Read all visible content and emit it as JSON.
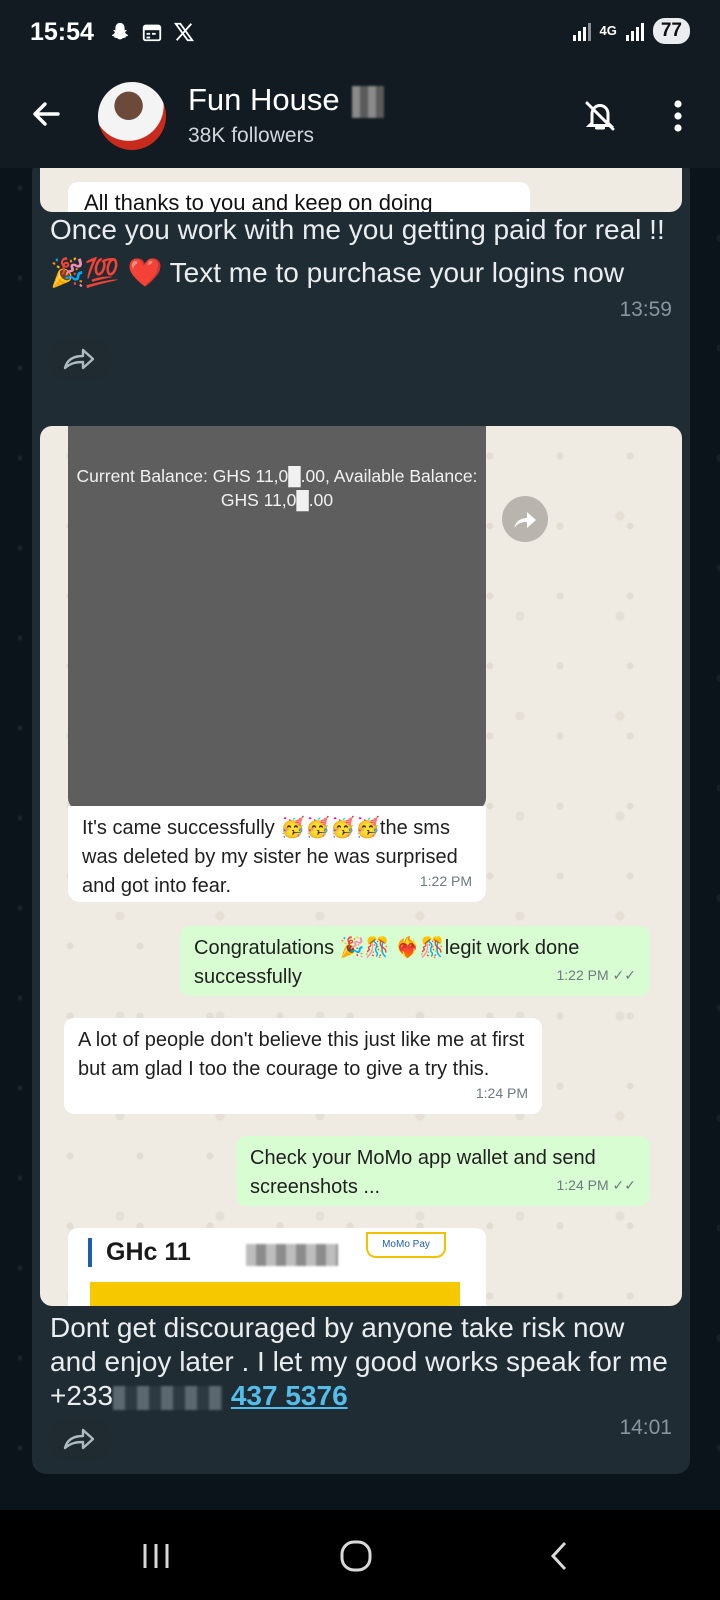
{
  "status_bar": {
    "time": "15:54",
    "network": "4G",
    "battery": "77"
  },
  "header": {
    "channel_name": "Fun House",
    "followers": "38K followers"
  },
  "messages": [
    {
      "preview_text": "All thanks to you and keep on doing",
      "text": "Once you work with me you getting paid for real !!🎉💯 ❤️  Text me to purchase your logins now",
      "time": "13:59"
    },
    {
      "screenshot": {
        "balance_text": "Current Balance: GHS 11,0█.00, Available Balance: GHS 11,0█.00",
        "bubbles": [
          {
            "dir": "in",
            "text": "It's came successfully 🥳🥳🥳🥳the sms was deleted by my sister he was surprised and got into fear.",
            "time": "1:22 PM"
          },
          {
            "dir": "out",
            "text": "Congratulations 🎉🎊 ❤️‍🔥🎊legit work done successfully",
            "time": "1:22 PM ✓✓"
          },
          {
            "dir": "in",
            "text": "A lot of people don't believe this just like me at first but am glad I too the courage to give a try this.",
            "time": "1:24 PM"
          },
          {
            "dir": "out",
            "text": "Check your MoMo app wallet and send screenshots ...",
            "time": "1:24 PM ✓✓"
          }
        ],
        "momo_amount": "GHc 11",
        "momo_pay": "MoMo Pay"
      },
      "text_prefix": "Dont get discouraged by anyone take risk now and enjoy later . I let my good works speak for me  +233",
      "phone_suffix": "437 5376",
      "time": "14:01"
    }
  ]
}
